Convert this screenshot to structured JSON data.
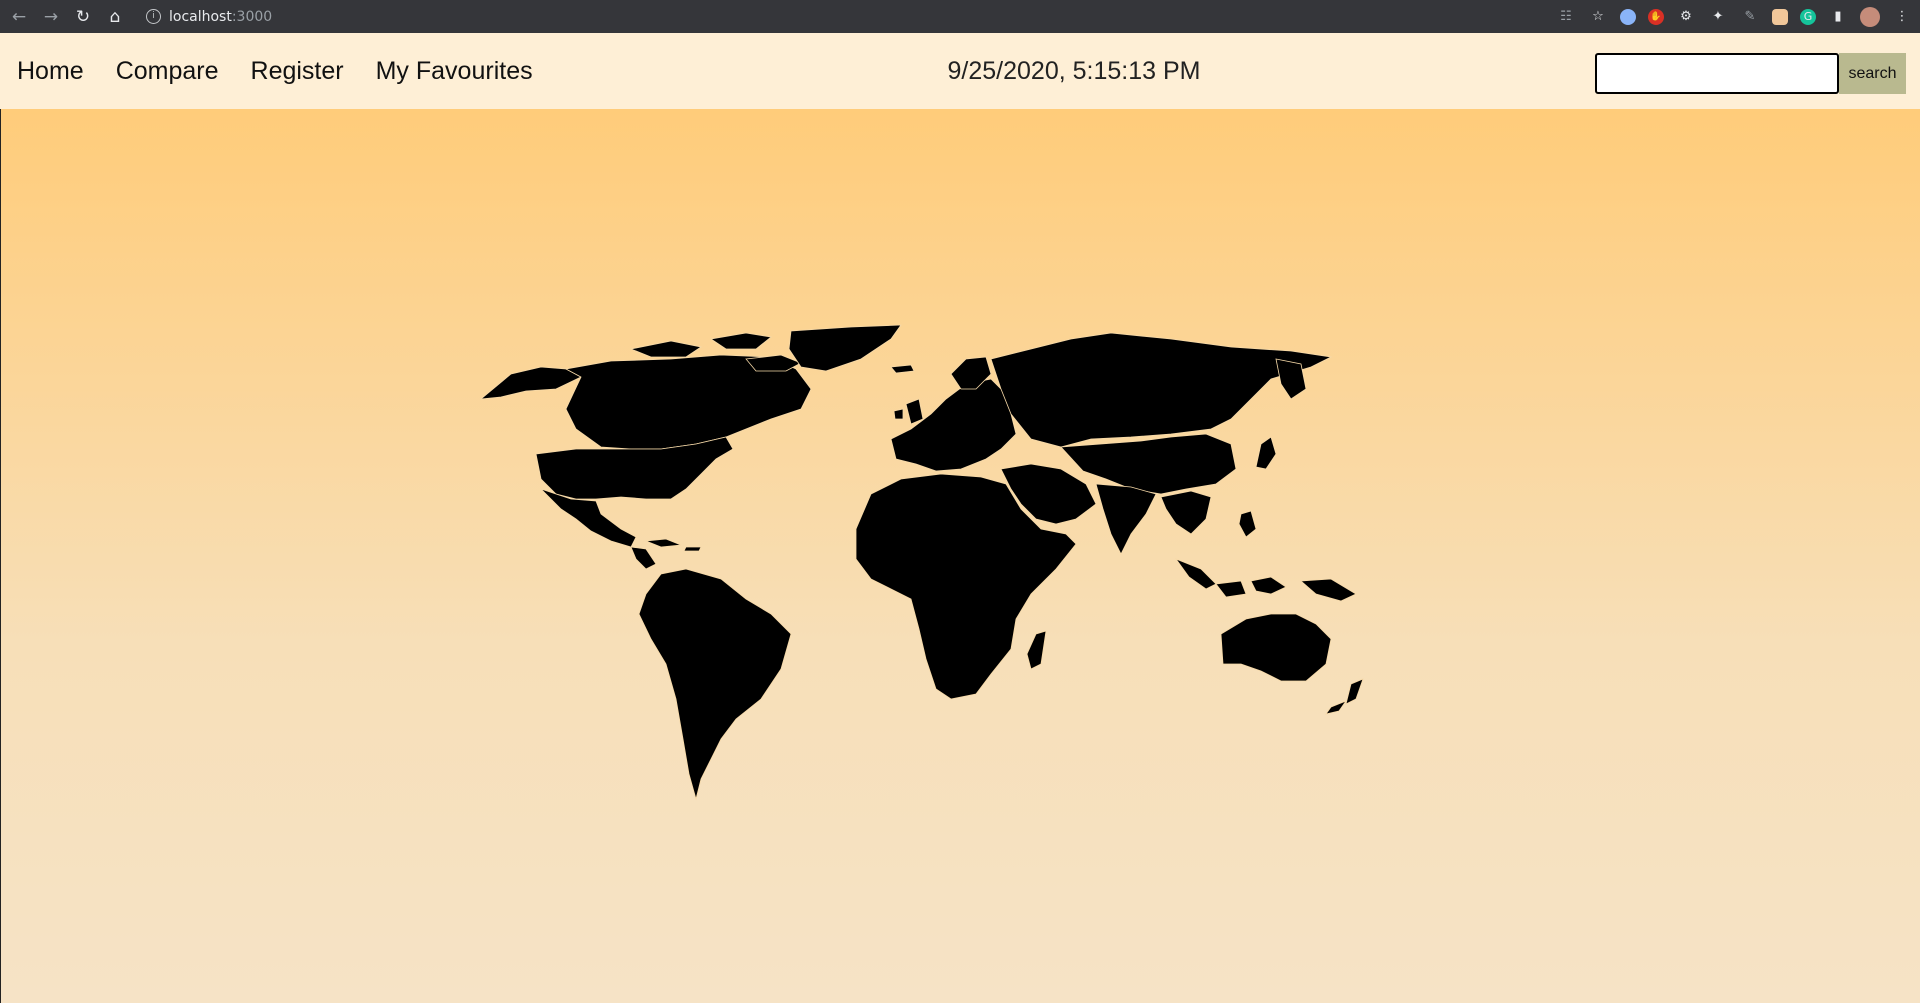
{
  "browser": {
    "url_host": "localhost",
    "url_port": ":3000",
    "icons": [
      "back-icon",
      "forward-icon",
      "reload-icon",
      "home-icon",
      "info-icon",
      "translate-icon",
      "star-icon",
      "extensions-icon",
      "profile-avatar",
      "menu-icon"
    ]
  },
  "nav": {
    "links": [
      "Home",
      "Compare",
      "Register",
      "My Favourites"
    ]
  },
  "clock": "9/25/2020, 5:15:13 PM",
  "search": {
    "value": "",
    "button_label": "search"
  },
  "colors": {
    "nav_bg": "#feefd6",
    "gradient_top": "#ffcc7a",
    "gradient_bottom": "#f6e3c6",
    "map_fill": "#000000",
    "search_button": "#b9b98f"
  }
}
